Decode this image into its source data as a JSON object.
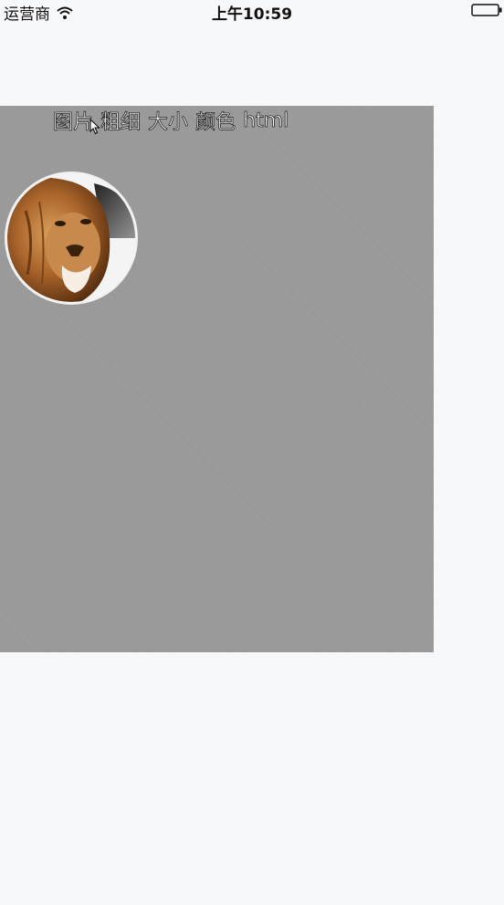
{
  "status_bar": {
    "carrier": "运营商",
    "time": "上午10:59"
  },
  "toolbar": {
    "items": [
      {
        "label": "图片"
      },
      {
        "label": "粗细"
      },
      {
        "label": "大小"
      },
      {
        "label": "颜色"
      },
      {
        "label": "html"
      }
    ]
  },
  "colors": {
    "panel_bg": "#9b9b9b",
    "page_bg": "#f7f8fa"
  },
  "icons": {
    "wifi": "wifi-icon",
    "battery": "battery-icon",
    "cursor": "cursor-icon",
    "avatar": "lion-avatar-image"
  }
}
